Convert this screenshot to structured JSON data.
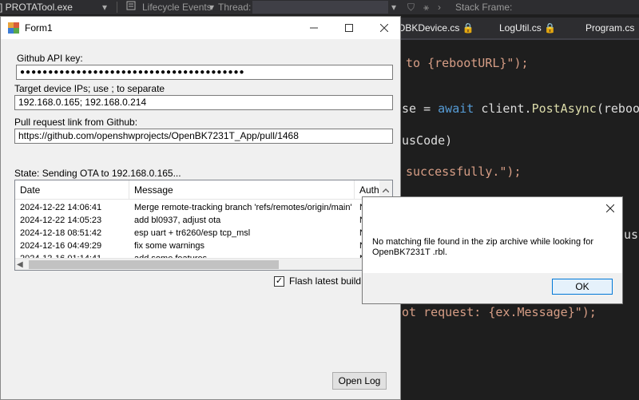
{
  "ide": {
    "toolbar": {
      "process": "] PROTATool.exe",
      "lifecycle": "Lifecycle Events",
      "thread": "Thread:",
      "stack": "Stack Frame:"
    },
    "tabs": [
      "OBKDevice.cs",
      "LogUtil.cs",
      "Program.cs"
    ],
    "code": {
      "line1_kw": "to",
      "line1_str": "{rebootURL}\");",
      "line2_pre": "se = ",
      "line2_kw": "await",
      "line2_mid": " client.",
      "line2_fn": "PostAsync",
      "line2_post": "(rebootURL",
      "line3": "usCode)",
      "line4_str": "successfully.\");",
      "line5": "usCo",
      "line6_str": "ot request: {ex.Message}\");"
    }
  },
  "form": {
    "title": "Form1",
    "controls": {
      "minimize": "—",
      "maximize": "☐",
      "close": "✕"
    },
    "api_key_label": "Github API key:",
    "api_key_value": "●●●●●●●●●●●●●●●●●●●●●●●●●●●●●●●●●●●●●●●●",
    "ips_label": "Target device IPs; use ; to separate",
    "ips_value": "192.168.0.165; 192.168.0.214",
    "pr_label": "Pull request link from Github:",
    "pr_value": "https://github.com/openshwprojects/OpenBK7231T_App/pull/1468",
    "state": "State: Sending OTA to 192.168.0.165...",
    "table": {
      "headers": [
        "Date",
        "Message",
        "Autho"
      ],
      "rows": [
        [
          "2024-12-22 14:06:41",
          "Merge remote-tracking branch 'refs/remotes/origin/main' int...",
          "N"
        ],
        [
          "2024-12-22 14:05:23",
          "add bl0937, adjust ota",
          "N"
        ],
        [
          "2024-12-18 08:51:42",
          "esp uart + tr6260/esp tcp_msl",
          "N"
        ],
        [
          "2024-12-16 04:49:29",
          "fix some warnings",
          "N"
        ],
        [
          "2024-12-16 01:14:41",
          "add some features",
          "N"
        ]
      ]
    },
    "flash_label": "Flash latest build on c",
    "flash_checked": "✓",
    "open_log": "Open Log"
  },
  "message_box": {
    "text": "No matching file found in the zip archive while looking for OpenBK7231T .rbl.",
    "ok": "OK",
    "close": "✕"
  }
}
